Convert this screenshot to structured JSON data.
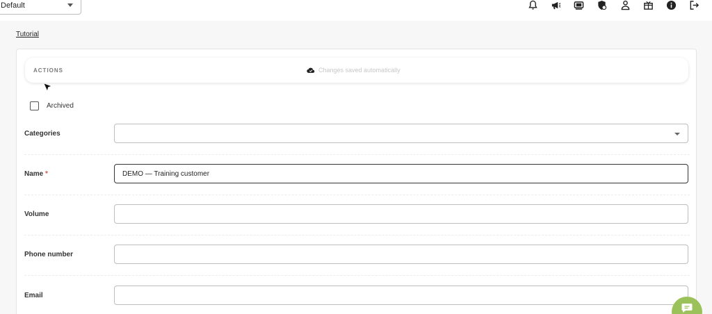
{
  "topbar": {
    "environment_select": {
      "value": "Default"
    }
  },
  "nav": {
    "tutorial_link": "Tutorial"
  },
  "actions_bar": {
    "label": "ACTIONS",
    "saved_status": "Changes saved automatically"
  },
  "form": {
    "archived_label": "Archived",
    "categories_label": "Categories",
    "categories_value": "",
    "name_label": "Name",
    "required_mark": "*",
    "name_value": "DEMO — Training customer",
    "volume_label": "Volume",
    "volume_value": "",
    "phone_label": "Phone number",
    "phone_value": "",
    "email_label": "Email",
    "email_value": ""
  },
  "icons": [
    "bell-icon",
    "megaphone-icon",
    "money-icon",
    "shield-icon",
    "user-icon",
    "gift-icon",
    "info-icon",
    "logout-icon",
    "chat-icon",
    "cloud-check-icon"
  ],
  "colors": {
    "badge": "#e0342c",
    "chat": "#9bc25a",
    "required": "#d9534f"
  }
}
